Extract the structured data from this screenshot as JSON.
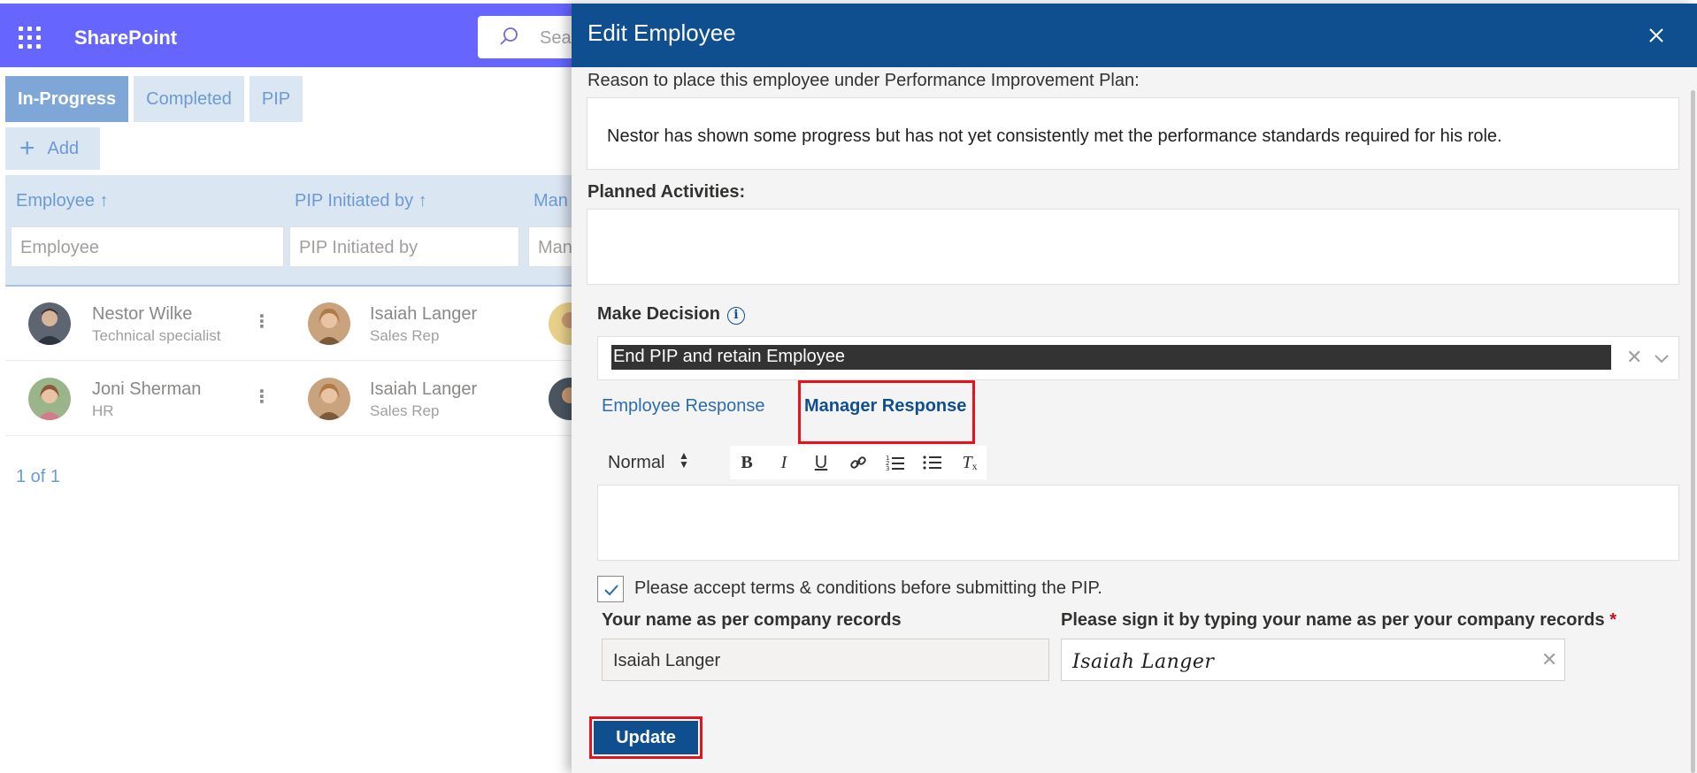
{
  "suitebar": {
    "app_title": "SharePoint",
    "search_placeholder": "Sea"
  },
  "list": {
    "tabs": [
      "In-Progress",
      "Completed",
      "PIP"
    ],
    "active_tab": "In-Progress",
    "add_label": "Add",
    "columns": [
      {
        "label": "Employee ↑",
        "filter_placeholder": "Employee"
      },
      {
        "label": "PIP Initiated by ↑",
        "filter_placeholder": "PIP Initiated by"
      },
      {
        "label": "Man",
        "filter_placeholder": "Man"
      }
    ],
    "rows": [
      {
        "employee": "Nestor Wilke",
        "employee_title": "Technical specialist",
        "initiator": "Isaiah Langer",
        "initiator_title": "Sales Rep"
      },
      {
        "employee": "Joni Sherman",
        "employee_title": "HR",
        "initiator": "Isaiah Langer",
        "initiator_title": "Sales Rep"
      }
    ],
    "pager": "1 of 1"
  },
  "panel": {
    "title": "Edit Employee",
    "reason_label": "Reason to place this employee under Performance Improvement Plan:",
    "reason_text": "Nestor has shown some progress but has not yet consistently met the performance standards required for his role.",
    "activities_label": "Planned Activities:",
    "activities_text": "",
    "decision_label": "Make Decision",
    "decision_value": "End PIP and retain Employee",
    "response_tabs": {
      "employee": "Employee Response",
      "manager": "Manager Response",
      "selected": "Manager Response"
    },
    "editor_toolbar": {
      "format": "Normal",
      "buttons": [
        "bold",
        "italic",
        "underline",
        "link",
        "ordered-list",
        "bullet-list",
        "clear-format"
      ]
    },
    "editor_text": "",
    "terms_checked": true,
    "terms_label": "Please accept terms & conditions before submitting the PIP.",
    "name_label": "Your name as per company records",
    "name_value": "Isaiah Langer",
    "sign_label": "Please sign it by typing your name as per your company records",
    "sign_required_mark": "*",
    "sign_value": "Isaiah Langer",
    "update_label": "Update"
  },
  "colors": {
    "suitebar": "#6666ff",
    "panel_header": "#0f4f8f",
    "highlight": "#e8121a",
    "accent_light": "#dbe6f3"
  }
}
